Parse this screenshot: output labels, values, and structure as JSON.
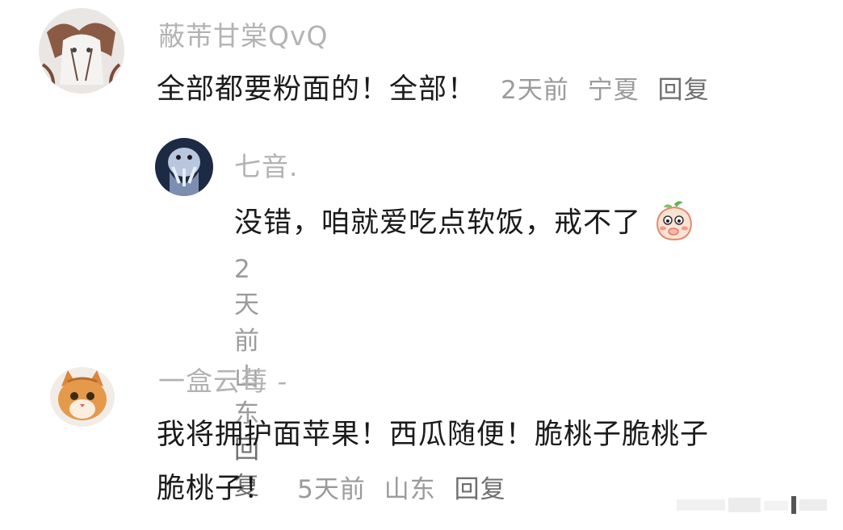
{
  "comments": [
    {
      "username": "蔽芾甘棠QvQ",
      "text": "全部都要粉面的！全部！",
      "time": "2天前",
      "location": "宁夏",
      "reply_label": "回复"
    },
    {
      "username": "七音.",
      "text": "没错，咱就爱吃点软饭，戒不了",
      "emoji": "shy-peach-emoji",
      "time": "2天前",
      "location": "山东",
      "reply_label": "回复"
    },
    {
      "username": "一盒云莓 -",
      "text_line1": "我将拥护面苹果！西瓜随便！脆桃子脆桃子",
      "text_line2": "脆桃子！",
      "time": "5天前",
      "location": "山东",
      "reply_label": "回复"
    }
  ],
  "colors": {
    "username": "#b3b3b3",
    "text": "#1b1b1b",
    "meta": "#9b9b9b",
    "background": "#ffffff"
  }
}
